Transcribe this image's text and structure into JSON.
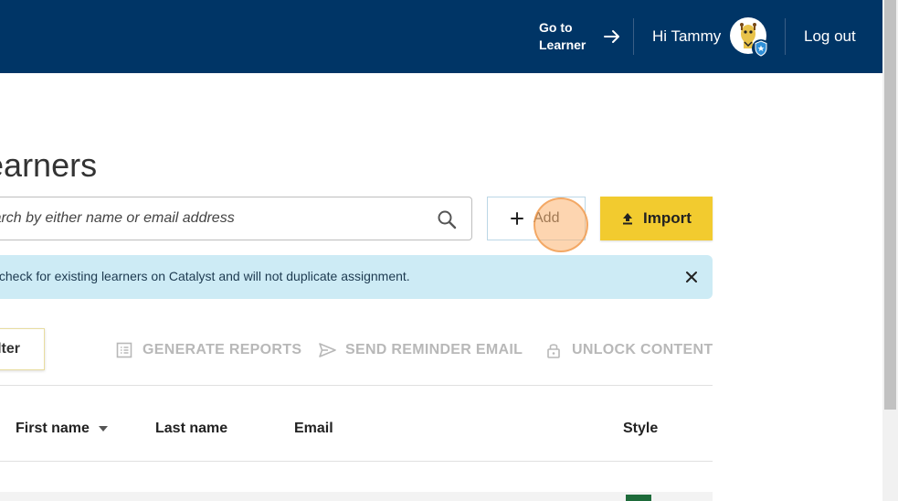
{
  "header": {
    "goto_label": "Go to Learner",
    "greeting": "Hi Tammy",
    "logout_label": "Log out",
    "background_color": "#003566"
  },
  "page": {
    "title": "Learners"
  },
  "search": {
    "placeholder": "Search by either name or email address"
  },
  "buttons": {
    "add_label": "Add",
    "import_label": "Import",
    "import_color": "#f2cb2f"
  },
  "banner": {
    "text": "Import will check for existing learners on Catalyst and will not duplicate assignment.",
    "background_color": "#cdebf5"
  },
  "toolbar": {
    "filter_label": "Filter",
    "actions": [
      {
        "label": "GENERATE REPORTS",
        "icon": "report-icon"
      },
      {
        "label": "SEND REMINDER EMAIL",
        "icon": "send-icon"
      },
      {
        "label": "UNLOCK CONTENT",
        "icon": "lock-icon"
      }
    ]
  },
  "table": {
    "columns": [
      "First name",
      "Last name",
      "Email",
      "Style"
    ],
    "sorted_column": "First name",
    "first_row_style_color": "#1e6b3a"
  }
}
